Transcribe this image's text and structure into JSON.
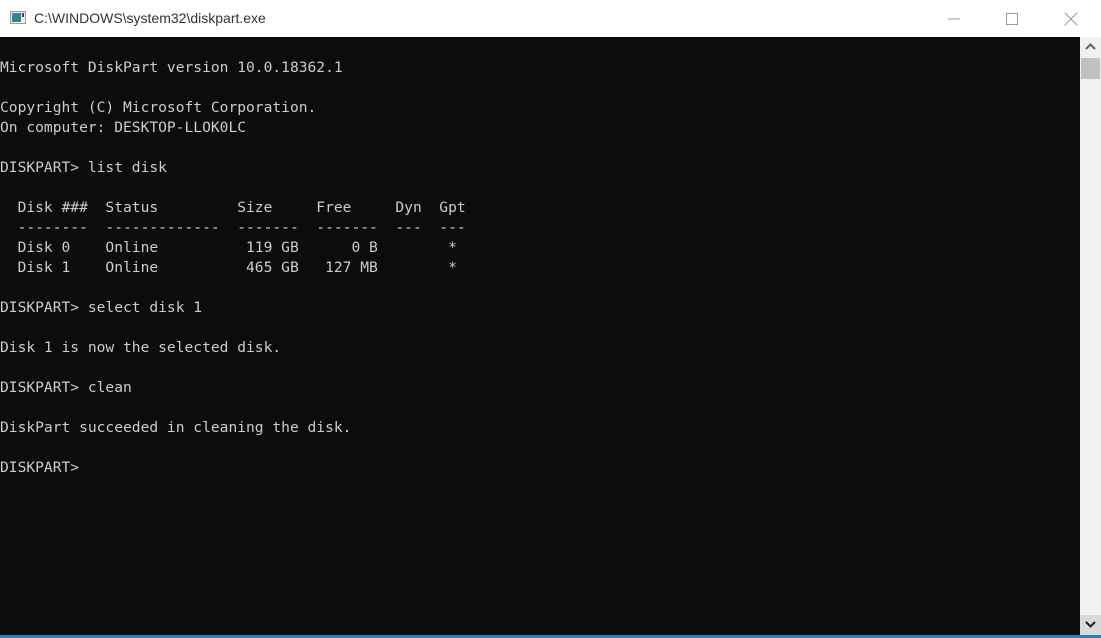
{
  "window": {
    "title": "C:\\WINDOWS\\system32\\diskpart.exe",
    "icon": "console-app-icon",
    "controls": {
      "minimize": "minimize-icon",
      "maximize": "maximize-icon",
      "close": "close-icon"
    }
  },
  "console": {
    "lines": [
      "Microsoft DiskPart version 10.0.18362.1",
      "",
      "Copyright (C) Microsoft Corporation.",
      "On computer: DESKTOP-LLOK0LC",
      "",
      "DISKPART> list disk",
      "",
      "  Disk ###  Status         Size     Free     Dyn  Gpt",
      "  --------  -------------  -------  -------  ---  ---",
      "  Disk 0    Online          119 GB      0 B        *",
      "  Disk 1    Online          465 GB   127 MB        *",
      "",
      "DISKPART> select disk 1",
      "",
      "Disk 1 is now the selected disk.",
      "",
      "DISKPART> clean",
      "",
      "DiskPart succeeded in cleaning the disk.",
      "",
      "DISKPART> "
    ],
    "disk_table": {
      "columns": [
        "Disk ###",
        "Status",
        "Size",
        "Free",
        "Dyn",
        "Gpt"
      ],
      "rows": [
        [
          "Disk 0",
          "Online",
          "119 GB",
          "0 B",
          "",
          "*"
        ],
        [
          "Disk 1",
          "Online",
          "465 GB",
          "127 MB",
          "",
          "*"
        ]
      ]
    },
    "prompt": "DISKPART> ",
    "colors": {
      "background": "#0c0c0c",
      "foreground": "#cccccc",
      "accent_border": "#2b84b8"
    }
  },
  "scrollbar": {
    "up": "chevron-up-icon",
    "down": "chevron-down-icon"
  }
}
